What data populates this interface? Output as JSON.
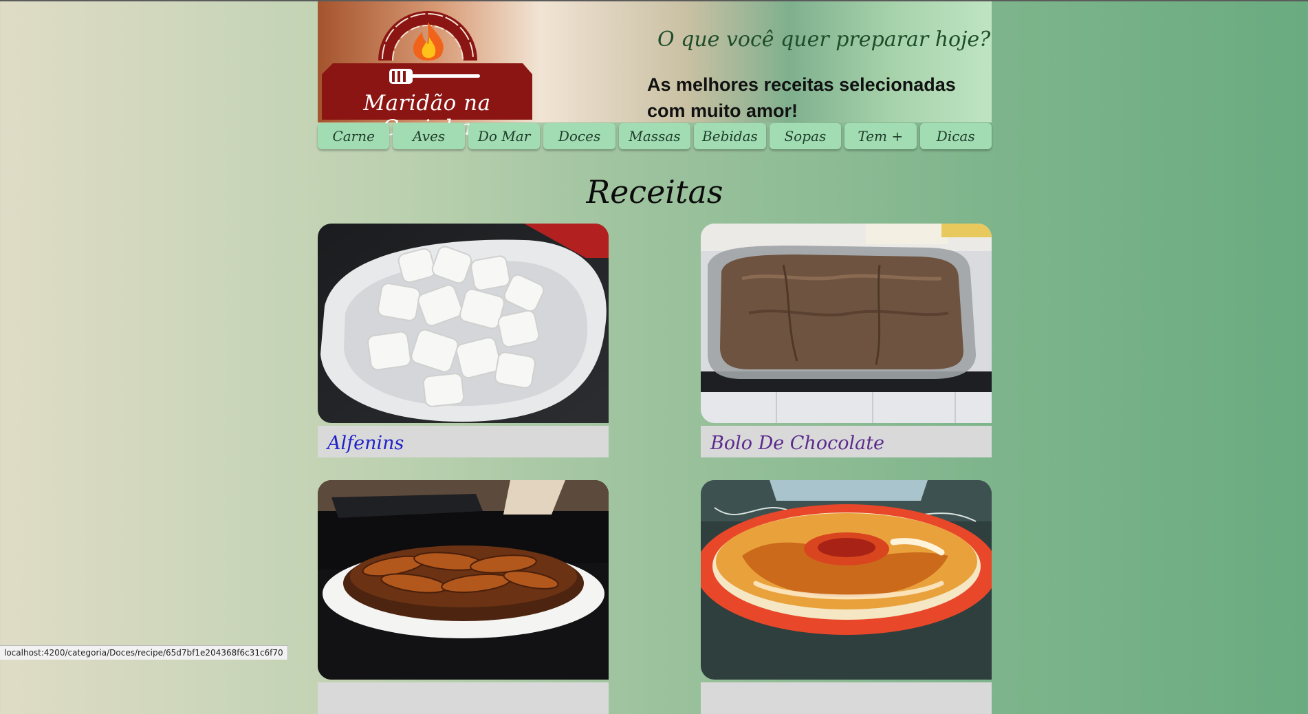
{
  "site": {
    "logo_text": "Maridão na Cozinha",
    "tagline": "O que você quer preparar hoje?",
    "subtitle": "As melhores receitas selecionadas com muito amor!"
  },
  "nav": [
    "Carne",
    "Aves",
    "Do Mar",
    "Doces",
    "Massas",
    "Bebidas",
    "Sopas",
    "Tem +",
    "Dicas"
  ],
  "section_title": "Receitas",
  "recipes": [
    {
      "title": "Alfenins",
      "title_color": "#1e22c8"
    },
    {
      "title": "Bolo De Chocolate",
      "title_color": "#5b2a8c"
    },
    {
      "title": "",
      "title_color": "#1e22c8"
    },
    {
      "title": "",
      "title_color": "#1e22c8"
    }
  ],
  "status_bar": "localhost:4200/categoria/Doces/recipe/65d7bf1e204368f6c31c6f70",
  "colors": {
    "nav_button": "#a2dcb3",
    "logo_red": "#8b1512",
    "caption_bg": "#d9d9d9"
  }
}
